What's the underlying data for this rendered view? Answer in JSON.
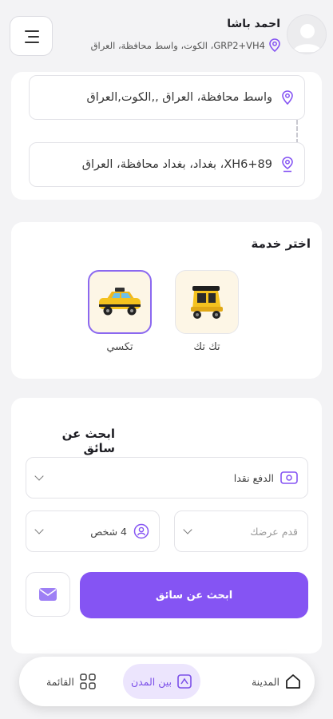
{
  "header": {
    "user_name": "احمد باشا",
    "location_text": "GRP2+VH4، الكوت، واسط محافظة، العراق"
  },
  "route": {
    "pickup": "واسط محافظة، العراق ,,الكوت,العراق",
    "destination": "XH6+89، بغداد، بغداد محافظة، العراق"
  },
  "service": {
    "title": "اختر خدمة",
    "options": [
      {
        "label": "تك تك",
        "icon": "tuk-tuk-icon"
      },
      {
        "label": "تكسي",
        "icon": "taxi-icon",
        "selected": true
      }
    ]
  },
  "search": {
    "title": "ابحث عن سائق",
    "payment_label": "الدفع نقدا",
    "offer_placeholder": "قدم عرضك",
    "passengers_label": "4 شخص",
    "submit_label": "ابحث عن سائق"
  },
  "nav": {
    "city": "المدينة",
    "between_cities": "بين المدن",
    "menu": "القائمة"
  },
  "colors": {
    "accent": "#8554f3",
    "active_nav_bg": "#ece5fd"
  }
}
